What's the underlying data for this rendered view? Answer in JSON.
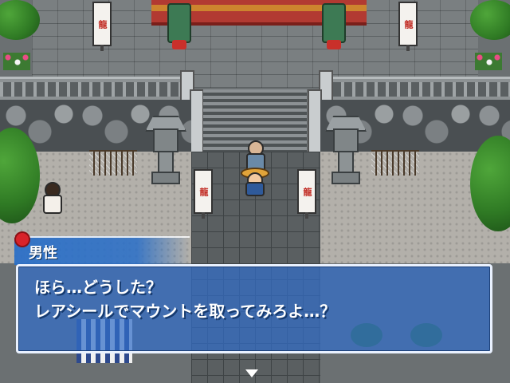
{
  "scene": {
    "banner_text": "龍"
  },
  "dialog": {
    "speaker": "男性",
    "lines": [
      "ほら…どうした？",
      "レアシールでマウントを取ってみろよ…？"
    ]
  },
  "colors": {
    "dialog_bg": "#3a6ec8",
    "dialog_border": "#e9f1ff",
    "text": "#ffffff"
  },
  "icons": {
    "name_ornament": "red-flower-icon",
    "continue_cursor": "down-arrow-icon"
  }
}
